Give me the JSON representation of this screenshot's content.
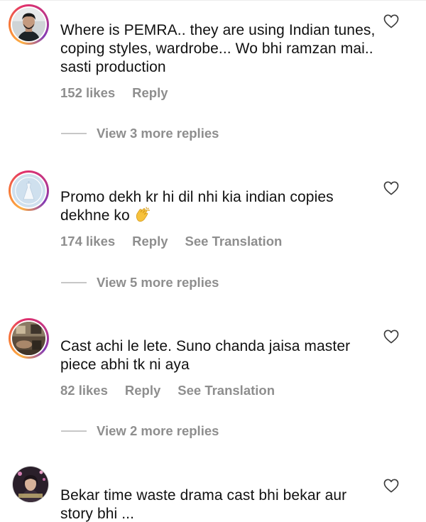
{
  "comments": [
    {
      "text": "Where is PEMRA.. they are using Indian tunes, coping styles, wardrobe... Wo bhi ramzan mai.. sasti production",
      "likes": "152 likes",
      "reply": "Reply",
      "view_replies": "View 3 more replies",
      "avatar_icon": "man-portrait-avatar",
      "story_ring": true
    },
    {
      "text": "Promo dekh kr hi dil nhi kia indian copies dekhne ko",
      "emoji": "clapping-hands-emoji",
      "likes": "174 likes",
      "reply": "Reply",
      "translation": "See Translation",
      "view_replies": "View 5 more replies",
      "avatar_icon": "dress-logo-avatar",
      "story_ring": true
    },
    {
      "text": "Cast achi le lete. Suno chanda jaisa master piece abhi tk ni aya",
      "likes": "82 likes",
      "reply": "Reply",
      "translation": "See Translation",
      "view_replies": "View 2 more replies",
      "avatar_icon": "room-photo-avatar",
      "story_ring": true
    },
    {
      "text": "Bekar time waste drama cast bhi bekar aur story bhi ...",
      "avatar_icon": "woman-portrait-avatar",
      "story_ring": false
    }
  ],
  "colors": {
    "meta_text": "#8e8e8e",
    "body_text": "#111111",
    "story_ring": [
      "#fcaf45",
      "#e1306c",
      "#833ab4"
    ]
  },
  "icons": {
    "like": "heart-outline-icon"
  }
}
